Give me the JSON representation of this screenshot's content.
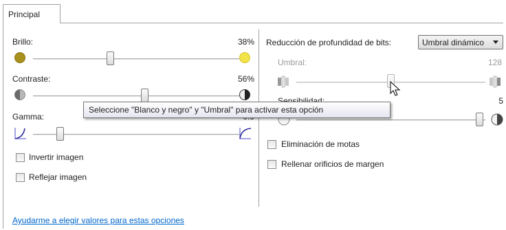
{
  "tab": {
    "label": "Principal"
  },
  "brightness": {
    "label": "Brillo:",
    "value": "38%",
    "level_percent": 38
  },
  "contrast": {
    "label": "Contraste:",
    "value": "56%",
    "level_percent": 56
  },
  "gamma": {
    "label": "Gamma:",
    "value": "0.9"
  },
  "invert": {
    "label": "Invertir imagen",
    "checked": false
  },
  "mirror": {
    "label": "Reflejar imagen",
    "checked": false
  },
  "bit_depth": {
    "label": "Reducción de profundidad de bits:",
    "selected": "Umbral dinámico"
  },
  "threshold": {
    "label": "Umbral:",
    "value": "128",
    "max": 255
  },
  "sensitivity": {
    "label": "Sensibilidad:",
    "value": "5"
  },
  "despeckle": {
    "label": "Eliminación de motas",
    "checked": false
  },
  "fill_holes": {
    "label": "Rellenar orificios de margen",
    "checked": false
  },
  "tooltip": {
    "text": "Seleccione \"Blanco y negro\" y \"Umbral\" para activar esta opción"
  },
  "help_link": {
    "text": "Ayudarme a elegir valores para estas opciones"
  },
  "colors": {
    "link": "#0066cc",
    "sun_dark": "#a8901c",
    "sun_light": "#f3e34a"
  }
}
